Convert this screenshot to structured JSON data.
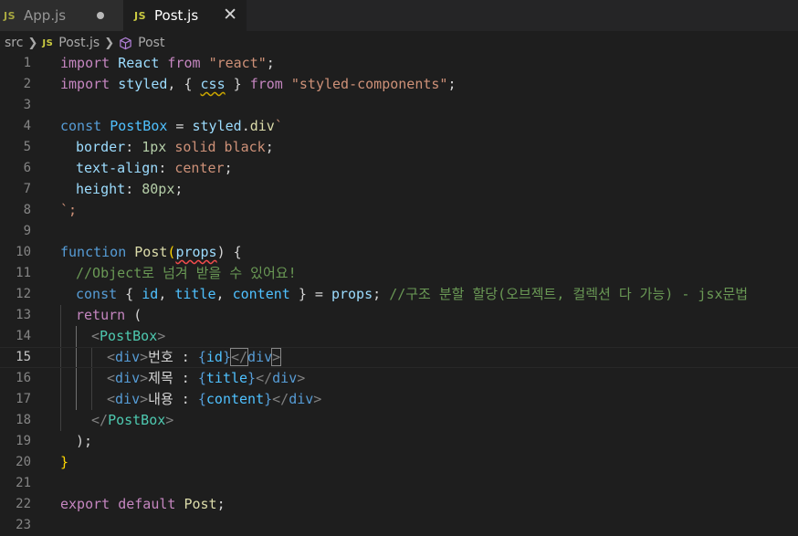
{
  "tabs": [
    {
      "badge": "JS",
      "label": "App.js",
      "modified": true
    },
    {
      "badge": "JS",
      "label": "Post.js",
      "active": true,
      "close": "✕"
    }
  ],
  "breadcrumb": {
    "folder": "src",
    "file_badge": "JS",
    "file": "Post.js",
    "symbol": "Post"
  },
  "colors": {
    "keyword": "#569cd6",
    "string": "#ce9178",
    "comment": "#6a9955",
    "function": "#dcdcaa",
    "variable": "#9cdcfe",
    "jsx_tag": "#4ec9b0"
  },
  "code": {
    "l1": [
      "import",
      "React",
      "from",
      "\"react\"",
      ";"
    ],
    "l2": [
      "import",
      "styled",
      ", { ",
      "css",
      " } ",
      "from",
      "\"styled-components\"",
      ";"
    ],
    "l4": [
      "const",
      "PostBox",
      " = ",
      "styled",
      ".",
      "div",
      "`"
    ],
    "l5": [
      "border",
      ": ",
      "1px",
      " solid black",
      ";"
    ],
    "l6": [
      "text-align",
      ": ",
      "center",
      ";"
    ],
    "l7": [
      "height",
      ": ",
      "80px",
      ";"
    ],
    "l8": [
      "`;"
    ],
    "l10": [
      "function",
      "Post",
      "(",
      "props",
      ") {"
    ],
    "l11": [
      "//Object로 넘겨 받을 수 있어요!"
    ],
    "l12": [
      "const",
      " { ",
      "id",
      ", ",
      "title",
      ", ",
      "content",
      " } = ",
      "props",
      "; ",
      "//구조 분할 할당(오브젝트, 컬렉션 다 가능) - jsx문법"
    ],
    "l13": [
      "return",
      " ("
    ],
    "l14": [
      "<",
      "PostBox",
      ">"
    ],
    "l15": [
      "<",
      "div",
      ">",
      "번호 : ",
      "{",
      "id",
      "}",
      "</",
      "div",
      ">"
    ],
    "l16": [
      "<",
      "div",
      ">",
      "제목 : ",
      "{",
      "title",
      "}",
      "</",
      "div",
      ">"
    ],
    "l17": [
      "<",
      "div",
      ">",
      "내용 : ",
      "{",
      "content",
      "}",
      "</",
      "div",
      ">"
    ],
    "l18": [
      "</",
      "PostBox",
      ">"
    ],
    "l19": [
      ");"
    ],
    "l20": [
      "}"
    ],
    "l22": [
      "export",
      "default",
      "Post",
      ";"
    ]
  }
}
